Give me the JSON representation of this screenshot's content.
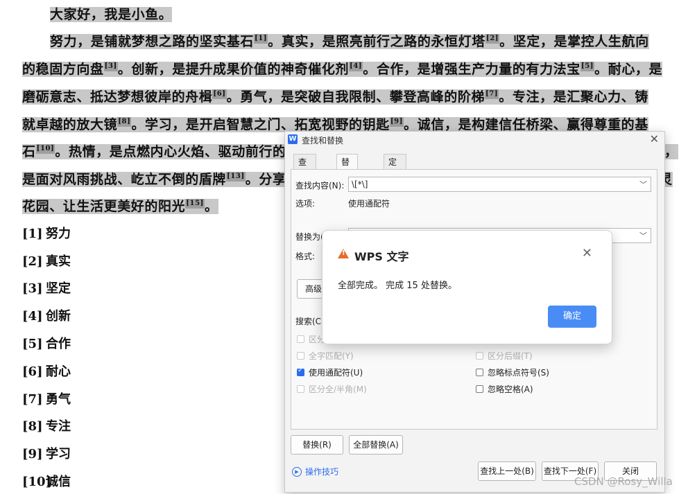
{
  "document": {
    "lines": [
      [
        "大家好，我是小鱼。"
      ],
      [
        "努力，是铺就梦想之路的坚实基石",
        "[1]",
        "。真实，是照亮前行之路的永恒灯塔",
        "[2]",
        "。坚定，是掌控人生航向"
      ],
      [
        "的稳固方向盘",
        "[3]",
        "。创新，是提升成果价值的神奇催化剂",
        "[4]",
        "。合作，是增强生产力量的有力法宝",
        "[5]",
        "。耐心，是"
      ],
      [
        "磨砺意志、抵达梦想彼岸的舟楫",
        "[6]",
        "。勇气，是突破自我限制、攀登高峰的阶梯",
        "[7]",
        "。专注，是汇聚心力、铸"
      ],
      [
        "就卓越的放大镜",
        "[8]",
        "。学习，是开启智慧之门、拓宽视野的钥匙",
        "[9]",
        "。诚信，是构建信任桥梁、赢得尊重的基"
      ],
      [
        "石",
        "[10]",
        "。热情，是点燃内心火焰、驱动前行的",
        "",
        "，"
      ],
      [
        "是面对风雨挑战、屹立不倒的盾牌",
        "[13]",
        "。分享",
        "",
        "灵"
      ],
      [
        "花园、让生活更美好的阳光",
        "[15]",
        "。"
      ]
    ],
    "footnotes": [
      {
        "num": "[1]",
        "text": "努力"
      },
      {
        "num": "[2]",
        "text": "真实"
      },
      {
        "num": "[3]",
        "text": "坚定"
      },
      {
        "num": "[4]",
        "text": "创新"
      },
      {
        "num": "[5]",
        "text": "合作"
      },
      {
        "num": "[6]",
        "text": "耐心"
      },
      {
        "num": "[7]",
        "text": "勇气"
      },
      {
        "num": "[8]",
        "text": "专注"
      },
      {
        "num": "[9]",
        "text": "学习"
      },
      {
        "num": "[10]",
        "text": "诚信"
      }
    ]
  },
  "dialog": {
    "title": "查找和替换",
    "app_icon": "W",
    "tabs": [
      "查找(D)",
      "替换(P)",
      "定位(G)"
    ],
    "find_label": "查找内容(N):",
    "find_value": "\\[*\\]",
    "options_label": "选项:",
    "options_value": "使用通配符",
    "replace_label": "替换为(",
    "format_label": "格式:",
    "advanced_button": "高级搜",
    "search_label": "搜索(C",
    "checkboxes": {
      "match_case": "区分",
      "whole_word": "全字匹配(Y)",
      "use_wildcards": "使用通配符(U)",
      "full_half": "区分全/半角(M)",
      "suffix": "区分后缀(T)",
      "ignore_punct": "忽略标点符号(S)",
      "ignore_space": "忽略空格(A)"
    },
    "replace_button": "替换(R)",
    "replace_all_button": "全部替换(A)",
    "tips_link": "操作技巧",
    "find_prev_button": "查找上一处(B)",
    "find_next_button": "查找下一处(F)",
    "close_button": "关闭"
  },
  "message": {
    "title": "WPS 文字",
    "text": "全部完成。 完成 15 处替换。",
    "ok": "确定"
  },
  "watermark": "CSDN @Rosy_Willa",
  "colors": {
    "accent": "#4a8cf5",
    "warning": "#e8692c",
    "highlight": "#c8c8c8"
  }
}
